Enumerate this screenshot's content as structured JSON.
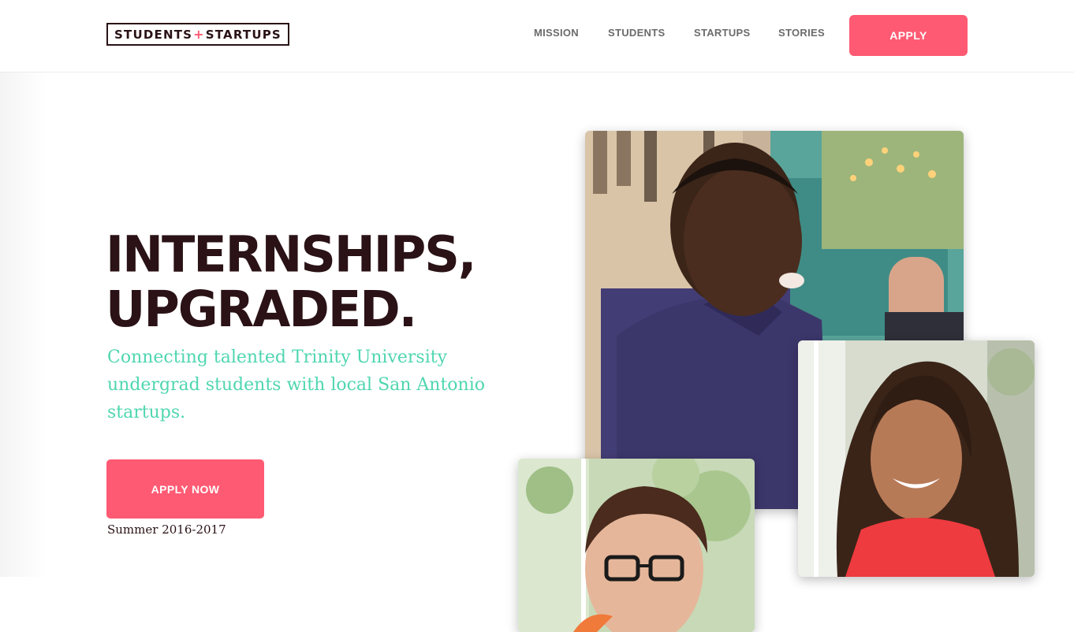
{
  "header": {
    "logo": {
      "left_text": "STUDENTS",
      "plus": "+",
      "right_text": "STARTUPS"
    },
    "nav": [
      {
        "label": "MISSION"
      },
      {
        "label": "STUDENTS"
      },
      {
        "label": "STARTUPS"
      },
      {
        "label": "STORIES"
      }
    ],
    "apply_label": "APPLY"
  },
  "hero": {
    "headline_line1": "INTERNSHIPS,",
    "headline_line2": "UPGRADED.",
    "subtext": "Connecting talented Trinity University undergrad students with local San Antonio startups.",
    "cta_label": "APPLY NOW",
    "season": "Summer 2016-2017"
  },
  "photos": [
    {
      "name": "student-photo-man-purple-shirt"
    },
    {
      "name": "student-photo-woman-red-top"
    },
    {
      "name": "student-photo-man-glasses"
    }
  ],
  "colors": {
    "accent": "#ff5a73",
    "teal": "#4fd6b0",
    "dark": "#2a1216",
    "nav_gray": "#6b6b6b"
  }
}
